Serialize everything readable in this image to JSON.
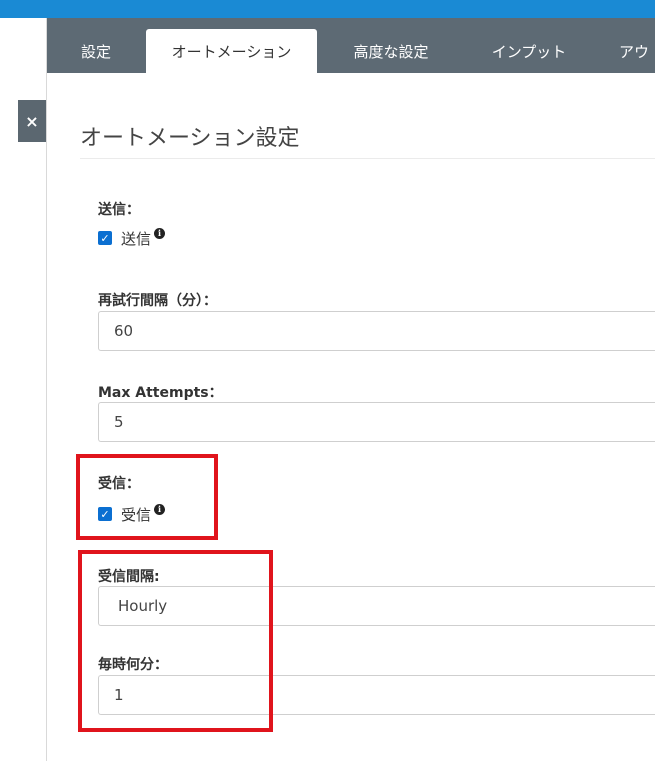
{
  "tabs": [
    {
      "label": "設定",
      "active": false
    },
    {
      "label": "オートメーション",
      "active": true
    },
    {
      "label": "高度な設定",
      "active": false
    },
    {
      "label": "インプット",
      "active": false
    },
    {
      "label": "アウ",
      "active": false
    }
  ],
  "close_button": {
    "label": "×"
  },
  "section": {
    "title": "オートメーション設定"
  },
  "form": {
    "send": {
      "label": "送信：",
      "checkbox_label": "送信",
      "checked": true
    },
    "retry_interval": {
      "label": "再試行間隔（分）：",
      "value": "60"
    },
    "max_attempts": {
      "label": "Max Attempts：",
      "value": "5"
    },
    "receive": {
      "label": "受信：",
      "checkbox_label": "受信",
      "checked": true
    },
    "receive_interval": {
      "label": "受信間隔:",
      "selected": "Hourly"
    },
    "minute_of_hour": {
      "label": "毎時何分：",
      "value": "1"
    }
  },
  "colors": {
    "top_bar": "#1a8ad4",
    "tab_bar": "#5d6a74",
    "checkbox": "#0b6fd1",
    "highlight": "#e0141c"
  },
  "icons": {
    "check": "check-icon",
    "info": "info-icon",
    "close": "close-icon"
  }
}
